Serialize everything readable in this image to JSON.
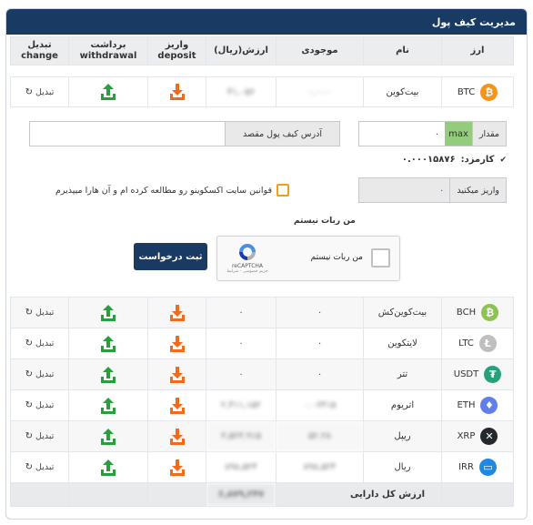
{
  "title": "مدیریت کیف پول",
  "headers": {
    "currency": "ارز",
    "name": "نام",
    "balance": "موجودی",
    "value": "ارزش(ریال)",
    "deposit_fa": "واریز",
    "deposit_en": "deposit",
    "withdraw_fa": "برداشت",
    "withdraw_en": "withdrawal",
    "change_fa": "تبدیل",
    "change_en": "change"
  },
  "btc": {
    "symbol": "BTC",
    "name": "بیت‌کوین",
    "balance": "۰.۰۰۰",
    "value": "۴۱,۰۵۶",
    "swap": "تبدیل",
    "color": "#f7931a",
    "icon": "bitcoin-icon"
  },
  "form": {
    "amount_label": "مقدار",
    "amount_value": "۰",
    "max_label": "max",
    "address_label": "آدرس کیف پول مقصد",
    "address_value": "",
    "fee_label": "کارمزد:",
    "fee_value": "۰.۰۰۰۱۵۸۷۶",
    "deposit_label": "واریز میکنید",
    "deposit_value": "۰",
    "terms": "قوانین سایت اکسکوینو رو مطالعه کرده ام و آن هارا میپذیرم",
    "robot_title": "من ربات نیستم",
    "captcha_text": "من ربات نیستم",
    "captcha_brand": "reCAPTCHA",
    "captcha_privacy": "حریم خصوصی - شرایط",
    "submit": "ثبت درخواست"
  },
  "rows": [
    {
      "symbol": "BCH",
      "name": "بیت‌کوین‌کش",
      "balance": "۰",
      "value": "۰",
      "swap": "تبدیل",
      "color": "#8dc351",
      "icon": "bitcoin-cash-icon",
      "glyph": "₿",
      "blur": false
    },
    {
      "symbol": "LTC",
      "name": "لایتکوین",
      "balance": "۰",
      "value": "۰",
      "swap": "تبدیل",
      "color": "#bfbfbf",
      "icon": "litecoin-icon",
      "glyph": "Ł",
      "blur": false
    },
    {
      "symbol": "USDT",
      "name": "تتر",
      "balance": "۰",
      "value": "۰",
      "swap": "تبدیل",
      "color": "#26a17b",
      "icon": "tether-icon",
      "glyph": "₮",
      "blur": false
    },
    {
      "symbol": "ETH",
      "name": "اتریوم",
      "balance": "۰.۰۶۴۱۵",
      "value": "۲,۴۱۱,۱۵۲",
      "swap": "تبدیل",
      "color": "#627eea",
      "icon": "ethereum-icon",
      "glyph": "♦",
      "blur": true
    },
    {
      "symbol": "XRP",
      "name": "ریپل",
      "balance": "۵۲.۲۸",
      "value": "۳,۵۲۳,۹۱۵",
      "swap": "تبدیل",
      "color": "#23292f",
      "icon": "ripple-icon",
      "glyph": "✕",
      "blur": true
    },
    {
      "symbol": "IRR",
      "name": "ریال",
      "balance": "۸۹۸,۵۲۴",
      "value": "۸۹۸,۵۲۴",
      "swap": "تبدیل",
      "color": "#1e88e5",
      "icon": "rial-card-icon",
      "glyph": "▭",
      "blur": true
    }
  ],
  "total": {
    "label": "ارزش کل دارایی",
    "value": "۶,۸۷۹,۲۴۷"
  },
  "colors": {
    "header": "#183a63",
    "deposit": "#f26b1d",
    "withdraw": "#2a9d3e"
  }
}
